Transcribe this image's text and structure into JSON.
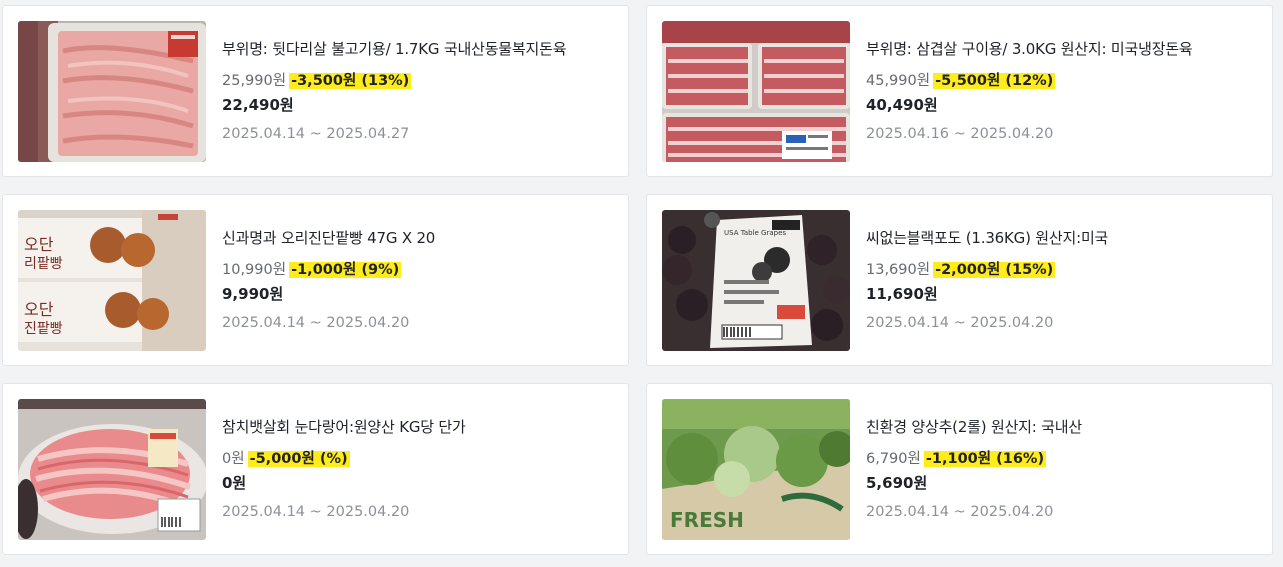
{
  "products": [
    {
      "title": "부위명: 뒷다리살 불고기용/ 1.7KG 국내산동물복지돈육",
      "original_price": "25,990원",
      "discount": "-3,500원 (13%)",
      "final_price": "22,490원",
      "period": "2025.04.14 ~ 2025.04.27"
    },
    {
      "title": "부위명: 삼겹살 구이용/ 3.0KG 원산지: 미국냉장돈육",
      "original_price": "45,990원",
      "discount": "-5,500원 (12%)",
      "final_price": "40,490원",
      "period": "2025.04.16 ~ 2025.04.20"
    },
    {
      "title": "신과명과 오리진단팥빵 47G X 20",
      "original_price": "10,990원",
      "discount": "-1,000원 (9%)",
      "final_price": "9,990원",
      "period": "2025.04.14 ~ 2025.04.20"
    },
    {
      "title": "씨없는블랙포도 (1.36KG) 원산지:미국",
      "original_price": "13,690원",
      "discount": "-2,000원 (15%)",
      "final_price": "11,690원",
      "period": "2025.04.14 ~ 2025.04.20"
    },
    {
      "title": "참치뱃살회 눈다랑어:원양산 KG당 단가",
      "original_price": "0원",
      "discount": "-5,000원 (%)",
      "final_price": "0원",
      "period": "2025.04.14 ~ 2025.04.20"
    },
    {
      "title": "친환경 양상추(2롤) 원산지: 국내산",
      "original_price": "6,790원",
      "discount": "-1,100원 (16%)",
      "final_price": "5,690원",
      "period": "2025.04.14 ~ 2025.04.20"
    }
  ],
  "icons": {
    "images": [
      "pork-leg-meat-photo",
      "pork-belly-photo",
      "red-bean-bread-photo",
      "black-grapes-photo",
      "tuna-sashimi-photo",
      "lettuce-photo"
    ]
  },
  "colors": {
    "discount_highlight": "#ffec1a",
    "page_background": "#f2f3f5"
  },
  "image_text": {
    "grapes_label": "USA Table Grapes",
    "lettuce_box": "FRESH"
  }
}
